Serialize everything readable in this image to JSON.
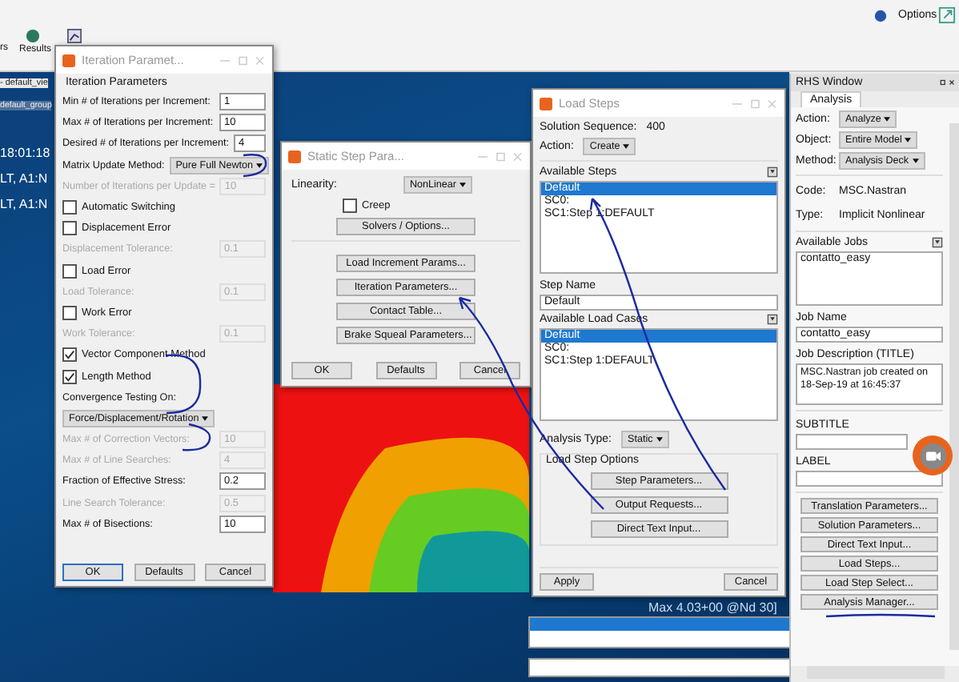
{
  "toolbar": {
    "tab_label": "rs",
    "results_label": "Results",
    "options_label": "Options"
  },
  "viewport": {
    "labels": [
      "- default_vie",
      "default_group",
      "18:01:18",
      "LT, A1:N",
      "LT, A1:N"
    ],
    "legend_text": "Max 4.03+00 @Nd 30]"
  },
  "iteration_dialog": {
    "title": "Iteration Paramet...",
    "heading": "Iteration Parameters",
    "rows": [
      {
        "kind": "field",
        "label": "Min # of Iterations per Increment:",
        "value": "1",
        "disabled": false
      },
      {
        "kind": "field",
        "label": "Max # of Iterations per Increment:",
        "value": "10",
        "disabled": false
      },
      {
        "kind": "field",
        "label": "Desired # of Iterations per Increment:",
        "value": "4",
        "disabled": false
      },
      {
        "kind": "dropdown",
        "label": "Matrix Update Method:",
        "value": "Pure Full Newton"
      },
      {
        "kind": "field",
        "label": "Number of Iterations per Update =",
        "value": "10",
        "disabled": true
      },
      {
        "kind": "checkbox",
        "label": "Automatic Switching",
        "checked": false
      },
      {
        "kind": "checkbox",
        "label": "Displacement Error",
        "checked": false
      },
      {
        "kind": "field",
        "label": "Displacement Tolerance:",
        "value": "0.1",
        "disabled": true
      },
      {
        "kind": "checkbox",
        "label": "Load Error",
        "checked": false
      },
      {
        "kind": "field",
        "label": "Load Tolerance:",
        "value": "0.1",
        "disabled": true
      },
      {
        "kind": "checkbox",
        "label": "Work Error",
        "checked": false
      },
      {
        "kind": "field",
        "label": "Work Tolerance:",
        "value": "0.1",
        "disabled": true
      },
      {
        "kind": "checkbox",
        "label": "Vector Component Method",
        "checked": true
      },
      {
        "kind": "checkbox",
        "label": "Length Method",
        "checked": true
      },
      {
        "kind": "label",
        "label": "Convergence Testing On:"
      },
      {
        "kind": "dropdown",
        "value": "Force/Displacement/Rotation"
      },
      {
        "kind": "field",
        "label": "Max # of Correction Vectors:",
        "value": "10",
        "disabled": true
      },
      {
        "kind": "field",
        "label": "Max # of Line Searches:",
        "value": "4",
        "disabled": true
      },
      {
        "kind": "field",
        "label": "Fraction of Effective Stress:",
        "value": "0.2",
        "disabled": false
      },
      {
        "kind": "field",
        "label": "Line Search Tolerance:",
        "value": "0.5",
        "disabled": true
      },
      {
        "kind": "field",
        "label": "Max # of Bisections:",
        "value": "10",
        "disabled": false
      }
    ],
    "buttons": [
      "OK",
      "Defaults",
      "Cancel"
    ]
  },
  "static_dialog": {
    "title": "Static Step Para...",
    "linearity_label": "Linearity:",
    "linearity": "NonLinear",
    "creep": {
      "label": "Creep",
      "checked": false
    },
    "solvers_button": "Solvers / Options...",
    "buttons": [
      "Load Increment Params...",
      "Iteration Parameters...",
      "Contact Table...",
      "Brake Squeal Parameters..."
    ],
    "footer_buttons": [
      "OK",
      "Defaults",
      "Cancel"
    ]
  },
  "load_steps_dialog": {
    "title": "Load Steps",
    "sequence_label": "Solution Sequence:",
    "sequence": "400",
    "action_label": "Action:",
    "action": "Create",
    "steps_label": "Available Steps",
    "steps": [
      {
        "name": "Default",
        "selected": true
      },
      {
        "name": "SC0:",
        "selected": false
      },
      {
        "name": "SC1:Step 1:DEFAULT",
        "selected": false
      }
    ],
    "step_name_label": "Step Name",
    "step_name": "Default",
    "cases_label": "Available Load Cases",
    "cases": [
      {
        "name": "Default",
        "selected": true
      },
      {
        "name": "SC0:",
        "selected": false
      },
      {
        "name": "SC1:Step 1:DEFAULT",
        "selected": false
      }
    ],
    "analysis_type_label": "Analysis Type:",
    "analysis_type": "Static",
    "options_label": "Load Step Options",
    "option_buttons": [
      "Step Parameters...",
      "Output Requests...",
      "Direct Text Input..."
    ],
    "apply": "Apply",
    "cancel": "Cancel"
  },
  "rhs_window": {
    "title": "RHS Window",
    "tab": "Analysis",
    "selectors": [
      {
        "label": "Action:",
        "value": "Analyze"
      },
      {
        "label": "Object:",
        "value": "Entire Model"
      },
      {
        "label": "Method:",
        "value": "Analysis Deck"
      }
    ],
    "info": [
      {
        "label": "Code:",
        "value": "MSC.Nastran"
      },
      {
        "label": "Type:",
        "value": "Implicit Nonlinear"
      }
    ],
    "jobs_label": "Available Jobs",
    "jobs": [
      "contatto_easy"
    ],
    "job_name_label": "Job Name",
    "job_name": "contatto_easy",
    "description_label": "Job Description (TITLE)",
    "description": "MSC.Nastran job created on 18-Sep-19 at 16:45:37",
    "subtitle_label": "SUBTITLE",
    "label_label": "LABEL",
    "buttons": [
      "Translation Parameters...",
      "Solution Parameters...",
      "Direct Text Input...",
      "Load Steps...",
      "Load Step Select...",
      "Analysis Manager..."
    ]
  }
}
